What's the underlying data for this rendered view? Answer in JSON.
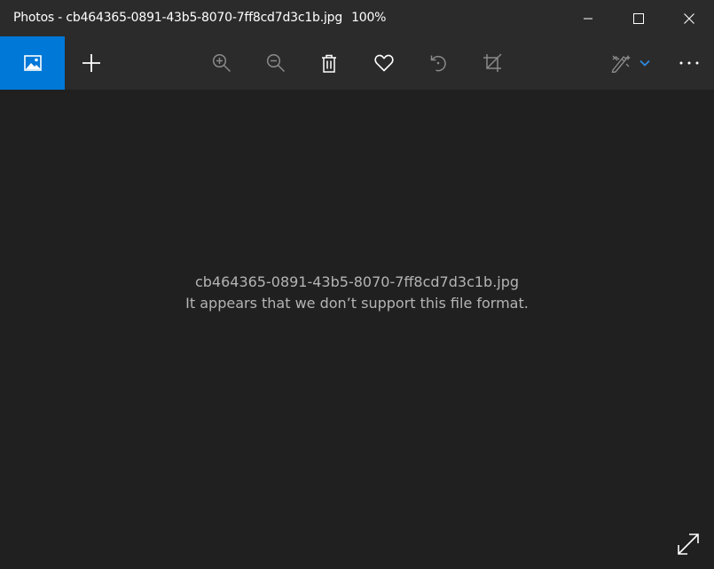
{
  "window": {
    "app_name": "Photos",
    "title_separator": " - ",
    "file_name": "cb464365-0891-43b5-8070-7ff8cd7d3c1b.jpg",
    "zoom_level": "100%"
  },
  "toolbar": {
    "accent_color": "#0078d7",
    "buttons": [
      {
        "icon": "image-icon"
      },
      {
        "icon": "add-icon"
      },
      {
        "icon": "zoom-in-icon"
      },
      {
        "icon": "zoom-out-icon"
      },
      {
        "icon": "delete-icon"
      },
      {
        "icon": "favorite-heart-icon"
      },
      {
        "icon": "rotate-icon"
      },
      {
        "icon": "crop-icon"
      },
      {
        "icon": "edit-create-icon"
      },
      {
        "icon": "chevron-down-icon"
      },
      {
        "icon": "more-options-icon"
      }
    ]
  },
  "main": {
    "file_name": "cb464365-0891-43b5-8070-7ff8cd7d3c1b.jpg",
    "error_message": "It appears that we don’t support this file format."
  },
  "footer": {
    "expand_icon": "full-screen-icon"
  }
}
